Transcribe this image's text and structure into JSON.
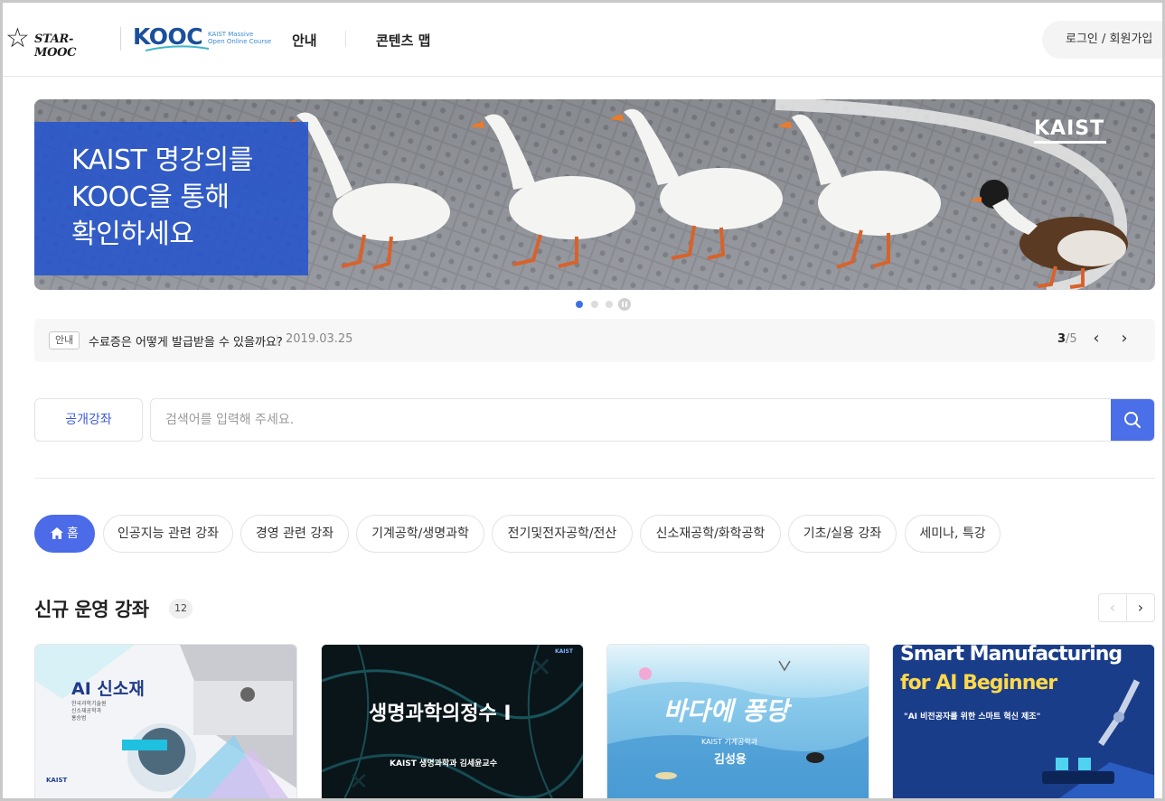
{
  "header": {
    "logo_star": "STAR-MOOC",
    "logo_kooc": "KOOC",
    "logo_kooc_sub": "KAIST Massive\nOpen Online Course",
    "nav": [
      {
        "label": "안내"
      },
      {
        "label": "콘텐츠 맵"
      }
    ],
    "login_label": "로그인 / 회원가입"
  },
  "banner": {
    "headline": "KAIST 명강의를\nKOOC을 통해\n확인하세요",
    "brand": "KAIST",
    "slides_total": 3,
    "active_slide": 1
  },
  "notice": {
    "tag": "안내",
    "text": "수료증은 어떻게 발급받을 수 있을까요?",
    "date": "2019.03.25",
    "page_current": "3",
    "page_total": "/5"
  },
  "search": {
    "category": "공개강좌",
    "placeholder": "검색어를 입력해 주세요."
  },
  "categories": [
    {
      "label": "홈",
      "active": true
    },
    {
      "label": "인공지능 관련 강좌"
    },
    {
      "label": "경영 관련 강좌"
    },
    {
      "label": "기계공학/생명과학"
    },
    {
      "label": "전기및전자공학/전산"
    },
    {
      "label": "신소재공학/화학공학"
    },
    {
      "label": "기초/실용 강좌"
    },
    {
      "label": "세미나, 특강"
    }
  ],
  "section": {
    "title": "신규 운영 강좌",
    "count": "12"
  },
  "cards": [
    {
      "title": "AI 신소재",
      "sub": "한국과학기술원\n신소재공학과\n홍승범",
      "brand": "KAIST"
    },
    {
      "title": "생명과학의정수 I",
      "sub": "KAIST 생명과학과 김세윤교수",
      "brand": "KAIST"
    },
    {
      "title": "바다에 퐁당",
      "sub": "KAIST 기계공학과",
      "sub2": "김성용"
    },
    {
      "title": "Smart Manufacturing",
      "title2": "for AI Beginner",
      "sub": "\"AI 비전공자를 위한 스마트 혁신 제조\""
    }
  ],
  "colors": {
    "accent": "#4b6be8",
    "banner_box": "#2353cd"
  },
  "icons": [
    "star-logo-icon",
    "search-icon",
    "home-icon",
    "chevron-left-icon",
    "chevron-right-icon",
    "pause-icon"
  ]
}
